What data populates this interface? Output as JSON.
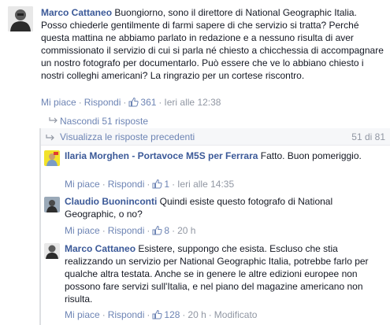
{
  "main_comment": {
    "author": "Marco Cattaneo",
    "text": "Buongiorno, sono il direttore di National Geographic Italia. Posso chiederle gentilmente di farmi sapere di che servizio si tratta? Perché questa mattina ne abbiamo parlato in redazione e a nessuno risulta di aver commissionato il servizio di cui si parla né chiesto a chicchessia di accompagnare un nostro fotografo per documentarlo. Può essere che ve lo abbiano chiesto i nostri colleghi americani? La ringrazio per un cortese riscontro.",
    "like_label": "Mi piace",
    "reply_label": "Rispondi",
    "likes": "361",
    "time": "Ieri alle 12:38"
  },
  "hide_replies_label": "Nascondi 51 risposte",
  "previous_replies": {
    "label": "Visualizza le risposte precedenti",
    "count": "51 di 81"
  },
  "replies": [
    {
      "author": "Ilaria Morghen - Portavoce M5S per Ferrara",
      "text": "Fatto. Buon pomeriggio.",
      "like_label": "Mi piace",
      "reply_label": "Rispondi",
      "likes": "1",
      "time": "Ieri alle 14:35",
      "modified": ""
    },
    {
      "author": "Claudio Buoninconti",
      "text": "Quindi esiste questo fotografo di National Geographic, o no?",
      "like_label": "Mi piace",
      "reply_label": "Rispondi",
      "likes": "8",
      "time": "20 h",
      "modified": ""
    },
    {
      "author": "Marco Cattaneo",
      "text": "Esistere, suppongo che esista. Escluso che stia realizzando un servizio per National Geographic Italia, potrebbe farlo per qualche altra testata. Anche se in genere le altre edizioni europee non possono fare servizi sull'Italia, e nel piano del magazine americano non risulta.",
      "like_label": "Mi piace",
      "reply_label": "Rispondi",
      "likes": "128",
      "time": "20 h",
      "modified": "Modificato"
    }
  ],
  "colors": {
    "link": "#3b5998",
    "action": "#6d84b4",
    "meta": "#9197a3",
    "text": "#141823"
  }
}
